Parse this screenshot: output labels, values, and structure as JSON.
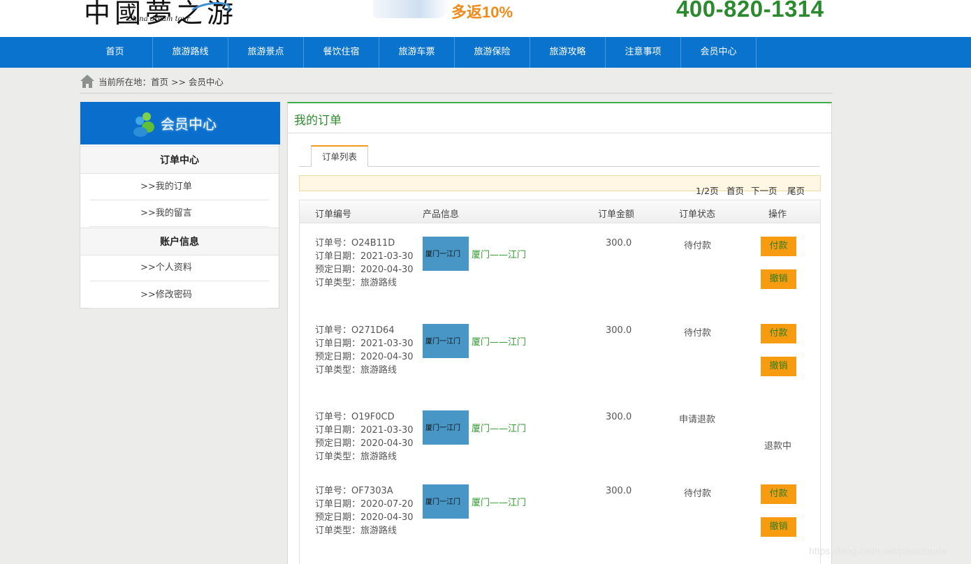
{
  "header": {
    "logo_main": "中國夢之游",
    "logo_sub": "China dream tour",
    "promo_text": "多返10%",
    "phone": "400-820-1314"
  },
  "nav": {
    "items": [
      "首页",
      "旅游路线",
      "旅游景点",
      "餐饮住宿",
      "旅游车票",
      "旅游保险",
      "旅游攻略",
      "注意事项",
      "会员中心"
    ]
  },
  "breadcrumb": {
    "text": "当前所在地：首页 >> 会员中心"
  },
  "sidebar": {
    "title": "会员中心",
    "groups": [
      {
        "label": "订单中心",
        "links": [
          ">>我的订单",
          ">>我的留言"
        ]
      },
      {
        "label": "账户信息",
        "links": [
          ">>个人资料",
          ">>修改密码"
        ]
      }
    ]
  },
  "main": {
    "title": "我的订单",
    "tab": "订单列表",
    "pager": {
      "page": "1/2页",
      "first": "首页",
      "next": "下一页",
      "last": "尾页"
    },
    "columns": [
      "订单编号",
      "产品信息",
      "订单金额",
      "订单状态",
      "操作"
    ],
    "orders": [
      {
        "no": "订单号：O24B11D",
        "date": "订单日期：2021-03-30",
        "reserve": "预定日期：2020-04-30",
        "type": "订单类型：旅游路线",
        "thumb": "厦门一江门",
        "product": "厦门——江门",
        "amount": "300.0",
        "status": "待付款",
        "pay": "付款",
        "cancel": "撤销"
      },
      {
        "no": "订单号：O271D64",
        "date": "订单日期：2021-03-30",
        "reserve": "预定日期：2020-04-30",
        "type": "订单类型：旅游路线",
        "thumb": "厦门一江门",
        "product": "厦门——江门",
        "amount": "300.0",
        "status": "待付款",
        "pay": "付款",
        "cancel": "撤销"
      },
      {
        "no": "订单号：O19F0CD",
        "date": "订单日期：2021-03-30",
        "reserve": "预定日期：2020-04-30",
        "type": "订单类型：旅游路线",
        "thumb": "厦门一江门",
        "product": "厦门——江门",
        "amount": "300.0",
        "status": "申请退款",
        "refund": "退款中"
      },
      {
        "no": "订单号：OF7303A",
        "date": "订单日期：2020-07-20",
        "reserve": "预定日期：2020-04-30",
        "type": "订单类型：旅游路线",
        "thumb": "厦门一江门",
        "product": "厦门——江门",
        "amount": "300.0",
        "status": "待付款",
        "pay": "付款",
        "cancel": "撤销"
      }
    ]
  },
  "watermark": "https://blog.csdn.net/pastclouds",
  "colors": {
    "nav_blue": "#0a73cd",
    "accent_green": "#3fae49",
    "button_orange": "#f79b10",
    "phone_green": "#2b8a2e"
  }
}
